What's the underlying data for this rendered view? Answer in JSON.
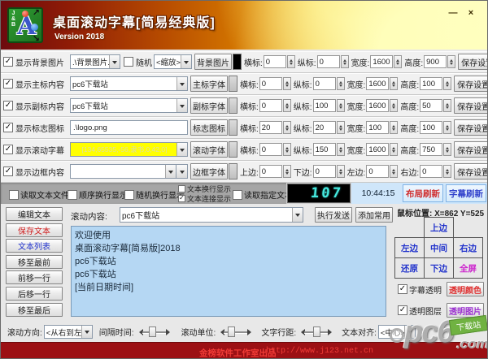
{
  "titlebar": {
    "title": "桌面滚动字幕[简易经典版]",
    "version": "Version 2018",
    "minimize": "—",
    "close": "×",
    "icon_letter": "A",
    "icon_side": "J&B",
    "arrow_ne": "↗",
    "arrow_se": "↘"
  },
  "config_rows": [
    {
      "label": "显示背景图片",
      "checked": true,
      "value": ".\\背景图片.jpg",
      "random_label": "随机",
      "scale_value": "<缩放>",
      "button": "背景图片",
      "swatch_color": "#000000",
      "fields": [
        {
          "label": "横标:",
          "value": "0"
        },
        {
          "label": "纵标:",
          "value": "0"
        },
        {
          "label": "宽度:",
          "value": "1600"
        },
        {
          "label": "高度:",
          "value": "900"
        }
      ],
      "save": "保存设置"
    },
    {
      "label": "显示主标内容",
      "checked": true,
      "value": "pc6下载站",
      "button": "主标字体",
      "fields": [
        {
          "label": "横标:",
          "value": "0"
        },
        {
          "label": "纵标:",
          "value": "0"
        },
        {
          "label": "宽度:",
          "value": "1600"
        },
        {
          "label": "高度:",
          "value": "100"
        }
      ],
      "save": "保存设置"
    },
    {
      "label": "显示副标内容",
      "checked": true,
      "value": "pc6下载站",
      "button": "副标字体",
      "fields": [
        {
          "label": "横标:",
          "value": "0"
        },
        {
          "label": "纵标:",
          "value": "100"
        },
        {
          "label": "宽度:",
          "value": "1600"
        },
        {
          "label": "高度:",
          "value": "50"
        }
      ],
      "save": "保存设置"
    },
    {
      "label": "显示标志图标",
      "checked": true,
      "value": ".\\logo.png",
      "button": "标志图标",
      "fields": [
        {
          "label": "横标:",
          "value": "20"
        },
        {
          "label": "纵标:",
          "value": "20"
        },
        {
          "label": "宽度:",
          "value": "100"
        },
        {
          "label": "高度:",
          "value": "100"
        }
      ],
      "save": "保存设置"
    },
    {
      "label": "显示滚动字幕",
      "checked": true,
      "value": "[134,65535,-56,隶书,0,42,0]",
      "highlight": "#ffff00",
      "button": "滚动字体",
      "fields": [
        {
          "label": "横标:",
          "value": "0"
        },
        {
          "label": "纵标:",
          "value": "150"
        },
        {
          "label": "宽度:",
          "value": "1600"
        },
        {
          "label": "高度:",
          "value": "750"
        }
      ],
      "save": "保存设置"
    },
    {
      "label": "显示边框内容",
      "checked": true,
      "value": "",
      "button": "边框字体",
      "fields": [
        {
          "label": "上边:",
          "value": "0"
        },
        {
          "label": "下边:",
          "value": "0"
        },
        {
          "label": "左边:",
          "value": "0"
        },
        {
          "label": "右边:",
          "value": "0"
        }
      ],
      "save": "保存设置"
    }
  ],
  "options_bar": {
    "checks": [
      "读取文本文件",
      "顺序换行显示",
      "随机换行显示"
    ],
    "stacked": [
      {
        "label": "文本换行显示",
        "checked": false
      },
      {
        "label": "文本连接显示",
        "checked": true
      }
    ],
    "check_right": "读取指定文本",
    "lcd": "107",
    "time": "10:44:15",
    "layout_refresh": "布局刷新",
    "subtitle_refresh": "字幕刷新"
  },
  "editor": {
    "buttons": [
      "编辑文本",
      "保存文本",
      "文本列表",
      "移至最前",
      "前移一行",
      "后移一行",
      "移至最后"
    ],
    "scroll_label": "滚动内容:",
    "scroll_value": "pc6下载站",
    "send_button": "执行发送",
    "add_button": "添加常用",
    "lines": [
      "欢迎使用",
      "桌面滚动字幕[简易版]2018",
      "pc6下载站",
      "pc6下载站",
      "[当前日期时间]"
    ]
  },
  "position_panel": {
    "mouse_label": "鼠标位置: X=862 Y=525",
    "grid": {
      "top": "上边",
      "left": "左边",
      "center": "中间",
      "right": "右边",
      "restore": "还原",
      "bottom": "下边",
      "full": "全屏"
    },
    "trans_check1": "字幕透明",
    "trans_btn1": "透明颜色",
    "trans_check2": "透明图层",
    "trans_btn2": "透明图片"
  },
  "bottom_bar": {
    "direction_label": "滚动方向:",
    "direction_value": "<从右到左>",
    "interval_label": "间隔时间:",
    "unit_label": "滚动单位:",
    "spacing_label": "文字行距:",
    "align_label": "文本对齐:",
    "align_value": "<中心>"
  },
  "statusbar": {
    "studio": "金榜软件工作室出品",
    "url": "http://www.j123.net.cn"
  },
  "watermark": {
    "name": "pc6",
    "tld": ".com",
    "tag": "下载站"
  },
  "colors": {
    "highlight_combo": "#ffff00",
    "lcd_text": "#46e8de",
    "status_bg": "#9c1014",
    "status_text": "#ef3b36",
    "textarea_bg": "#b5d7f3",
    "titlebar_left": "#6d0a0e",
    "titlebar_right": "#fbe95a"
  }
}
